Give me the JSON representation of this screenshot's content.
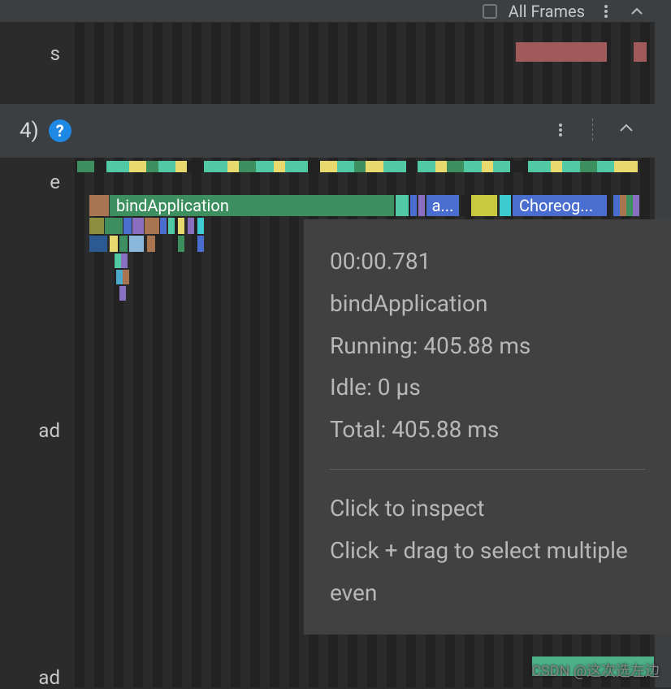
{
  "topstrip": {
    "all_frames_label": "All Frames"
  },
  "left_labels": {
    "l1": "s",
    "l2": "e",
    "l3": "ad",
    "l4": "ad"
  },
  "subheader": {
    "title_fragment": "4)"
  },
  "flame": {
    "bindApplication": "bindApplication",
    "a": "a...",
    "choreog": "Choreog..."
  },
  "tooltip": {
    "timestamp": "00:00.781",
    "name": "bindApplication",
    "running_label": "Running:",
    "running_value": "405.88 ms",
    "idle_label": "Idle:",
    "idle_value": "0 µs",
    "total_label": "Total:",
    "total_value": "405.88 ms",
    "hint1": "Click to inspect",
    "hint2": "Click + drag to select multiple even"
  },
  "watermark": "CSDN @这次选左边",
  "colors": {
    "green": "#3d8f5f",
    "teal": "#51c9a5",
    "yellow": "#e8d96f",
    "blue": "#4a6ecf",
    "brown": "#a87550",
    "purple": "#8a6fc0",
    "cyan": "#4aa8c9",
    "cyanBright": "#3ccbd0",
    "red": "#a15a5a",
    "olive": "#8d8f3f",
    "darkblue": "#2a5a90",
    "skyblue": "#8ab8dc"
  }
}
